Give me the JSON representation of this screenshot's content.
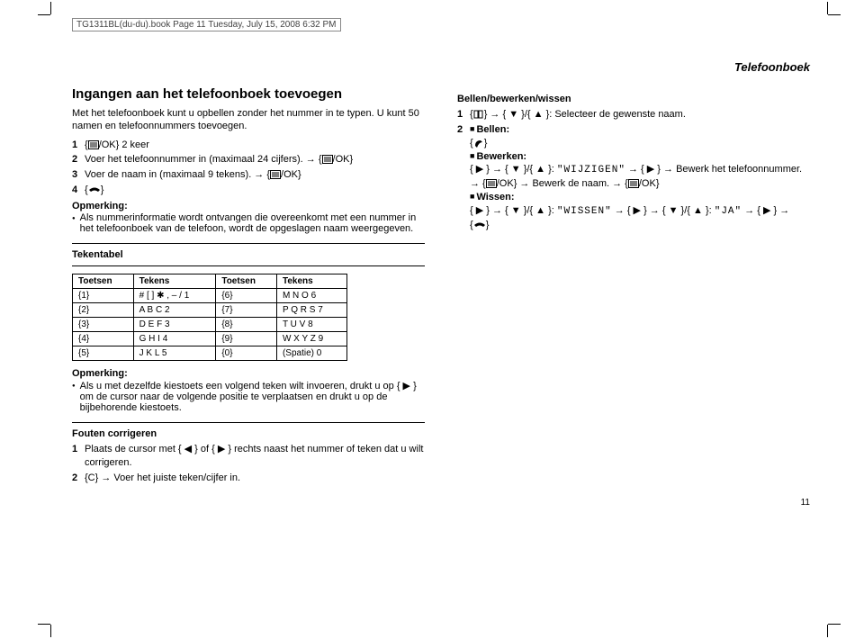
{
  "bookmark": "TG1311BL(du-du).book  Page 11  Tuesday, July 15, 2008  6:32 PM",
  "sectionLabel": "Telefoonboek",
  "left": {
    "h2": "Ingangen aan het telefoonboek toevoegen",
    "intro": "Met het telefoonboek kunt u opbellen zonder het nummer in te typen. U kunt 50 namen en telefoonnummers toevoegen.",
    "step1_pre": "{",
    "step1_post": "} 2 keer",
    "step2_pre": "Voer het telefoonnummer in (maximaal 24 cijfers). → {",
    "step2_post": "}",
    "step3_pre": "Voer de naam in (maximaal 9 tekens). → {",
    "step3_post": "}",
    "noteLabel": "Opmerking:",
    "noteText": "Als nummerinformatie wordt ontvangen die overeenkomt met een nummer in het telefoonboek van de telefoon, wordt de opgeslagen naam weergegeven.",
    "tableTitle": "Tekentabel",
    "th1": "Toetsen",
    "th2": "Tekens",
    "th3": "Toetsen",
    "th4": "Tekens",
    "rows": [
      {
        "k1": "{1}",
        "c1": "#  [  ]  ✱  ,  –  /  1",
        "k2": "{6}",
        "c2": "M  N  O  6"
      },
      {
        "k1": "{2}",
        "c1": "A  B  C  2",
        "k2": "{7}",
        "c2": "P  Q  R  S  7"
      },
      {
        "k1": "{3}",
        "c1": "D  E  F  3",
        "k2": "{8}",
        "c2": "T  U  V  8"
      },
      {
        "k1": "{4}",
        "c1": "G  H  I  4",
        "k2": "{9}",
        "c2": "W  X  Y  Z  9"
      },
      {
        "k1": "{5}",
        "c1": "J  K  L  5",
        "k2": "{0}",
        "c2": "(Spatie)  0"
      }
    ],
    "note2Label": "Opmerking:",
    "note2Text": "Als u met dezelfde kiestoets een volgend teken wilt invoeren, drukt u op { ▶ } om de cursor naar de volgende positie te verplaatsen en drukt u op de bijbehorende kiestoets.",
    "fixTitle": "Fouten corrigeren",
    "fix1": "Plaats de cursor met { ◀ } of { ▶ } rechts naast het nummer of teken dat u wilt corrigeren.",
    "fix2": "{C} → Voer het juiste teken/cijfer in."
  },
  "right": {
    "h3": "Bellen/bewerken/wissen",
    "step1_mid": " → { ▼ }/{ ▲ }: Selecteer de gewenste naam.",
    "callLabel": "Bellen:",
    "editLabel": "Bewerken:",
    "editLine_a": "{ ▶ } → { ▼ }/{ ▲ }: ",
    "editLine_wijzigen": "\"WIJZIGEN\"",
    "editLine_b": " → { ▶ } → Bewerk het telefoonnummer.",
    "editLine2_a": "→ {",
    "editLine2_ok": "/OK",
    "editLine2_b": "} → Bewerk de naam. → {",
    "editLine2_c": "}",
    "delLabel": "Wissen:",
    "delLine_a": "{ ▶ } → { ▼ }/{ ▲ }: ",
    "delLine_wissen": "\"WISSEN\"",
    "delLine_b": " → { ▶ } → { ▼ }/{ ▲ }: ",
    "delLine_ja": "\"JA\"",
    "delLine_c": " → { ▶ } →"
  },
  "ok": "/OK",
  "pageNum": "11"
}
